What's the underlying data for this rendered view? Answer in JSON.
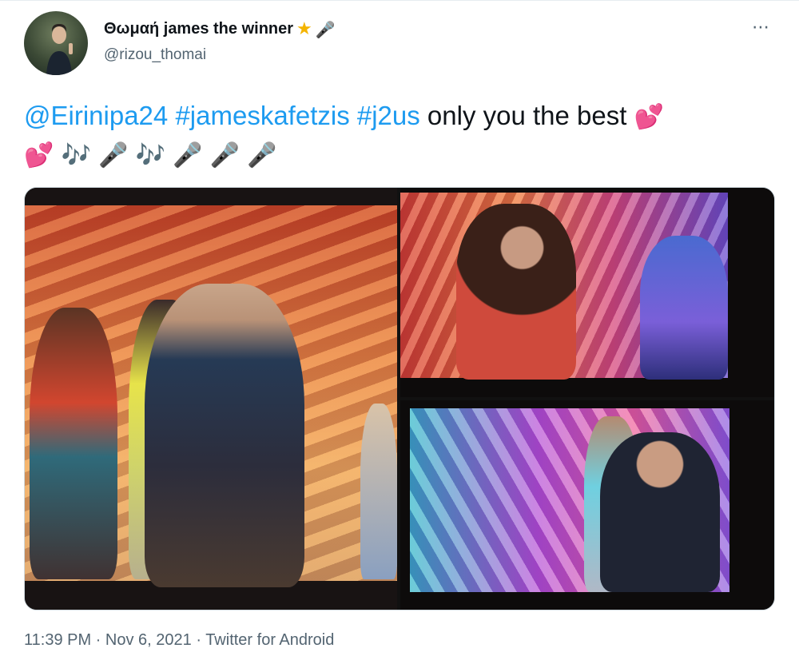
{
  "author": {
    "display_name": "Θωμαή james the winner",
    "name_emoji_1": "★",
    "name_emoji_2": "🎤",
    "handle": "@rizou_thomai"
  },
  "menu_icon": "⋯",
  "tweet": {
    "mention": "@Eirinipa24",
    "hashtag_1": "#jameskafetzis",
    "hashtag_2": "#j2us",
    "text": " only you the best ",
    "emoji_line_1": "💕",
    "emoji_line_2": [
      "💕",
      "🎶",
      "🎤",
      "🎶",
      "🎤",
      "🎤",
      "🎤"
    ]
  },
  "icons": {
    "heart": "two-hearts-icon",
    "note": "musical-notes-icon",
    "mic": "microphone-icon"
  },
  "meta": {
    "time": "11:39 PM",
    "sep1": " · ",
    "date": "Nov 6, 2021",
    "sep2": " · ",
    "source": "Twitter for Android"
  },
  "colors": {
    "link": "#1d9bf0",
    "secondary": "#536471"
  }
}
